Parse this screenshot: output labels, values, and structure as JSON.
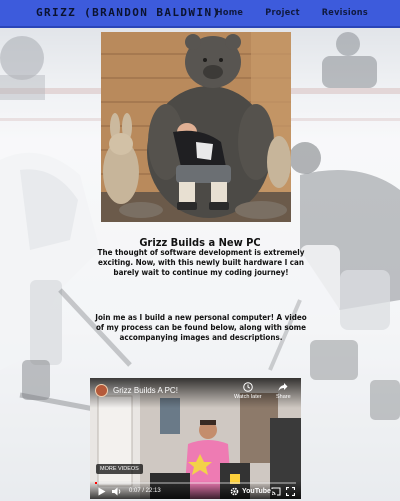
{
  "nav": {
    "brand": "GRIZZ (BRANDON BALDWIN)",
    "links": [
      "Home",
      "Project",
      "Revisions"
    ]
  },
  "hero": {
    "image": "man-sitting-on-bear-statue"
  },
  "intro": {
    "title": "Grizz Builds a New PC",
    "body": "The thought of software development is extremely exciting. Now, with this newly built hardware I can barely wait to continue my coding journey!"
  },
  "process": {
    "body": "Join me as I build a new personal computer! A video of my process can be found below, along with some accompanying images and descriptions."
  },
  "video": {
    "title": "Grizz Builds A PC!",
    "watch_later": "Watch later",
    "share": "Share",
    "more_videos": "MORE VIDEOS",
    "time": "0:07 / 22:13",
    "progress": 0.005,
    "brand": "YouTube",
    "accent": "#ff0000"
  },
  "colors": {
    "nav": "#3d5bdc",
    "nav_text": "#0b1330"
  }
}
